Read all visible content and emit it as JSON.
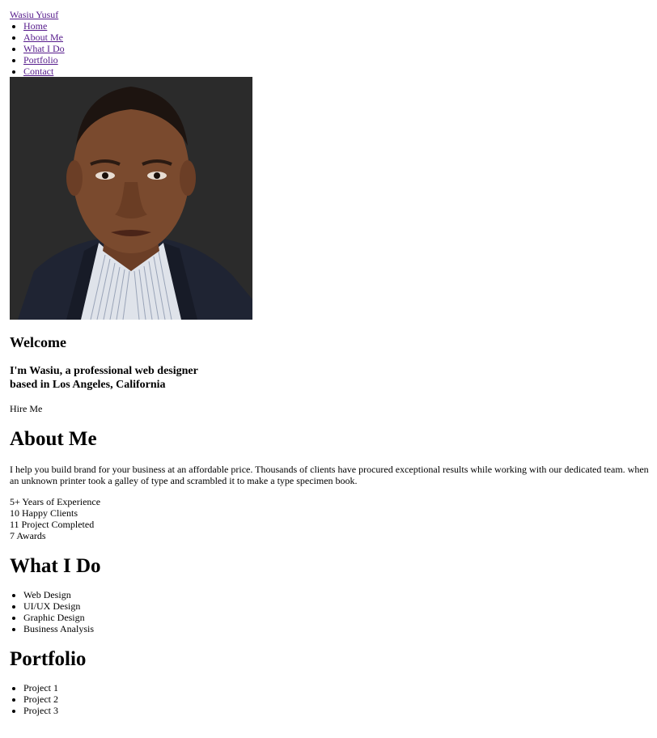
{
  "brand": "Wasiu Yusuf",
  "nav": [
    "Home",
    "About Me",
    "What I Do",
    "Portfolio",
    "Contact"
  ],
  "hero": {
    "heading": "Welcome",
    "tagline": "I'm Wasiu, a professional web designer based in Los Angeles, California",
    "cta": "Hire Me"
  },
  "about": {
    "heading": "About Me",
    "text": "I help you build brand for your business at an affordable price. Thousands of clients have procured exceptional results while working with our dedicated team. when an unknown printer took a galley of type and scrambled it to make a type specimen book.",
    "stats": [
      "5+ Years of Experience",
      "10 Happy Clients",
      "11 Project Completed",
      "7 Awards"
    ]
  },
  "services": {
    "heading": "What I Do",
    "items": [
      "Web Design",
      "UI/UX Design",
      "Graphic Design",
      "Business Analysis"
    ]
  },
  "portfolio": {
    "heading": "Portfolio",
    "items": [
      "Project 1",
      "Project 2",
      "Project 3"
    ]
  },
  "colors": {
    "link": "#551a8b",
    "photo_bg": "#2b2b2b"
  }
}
